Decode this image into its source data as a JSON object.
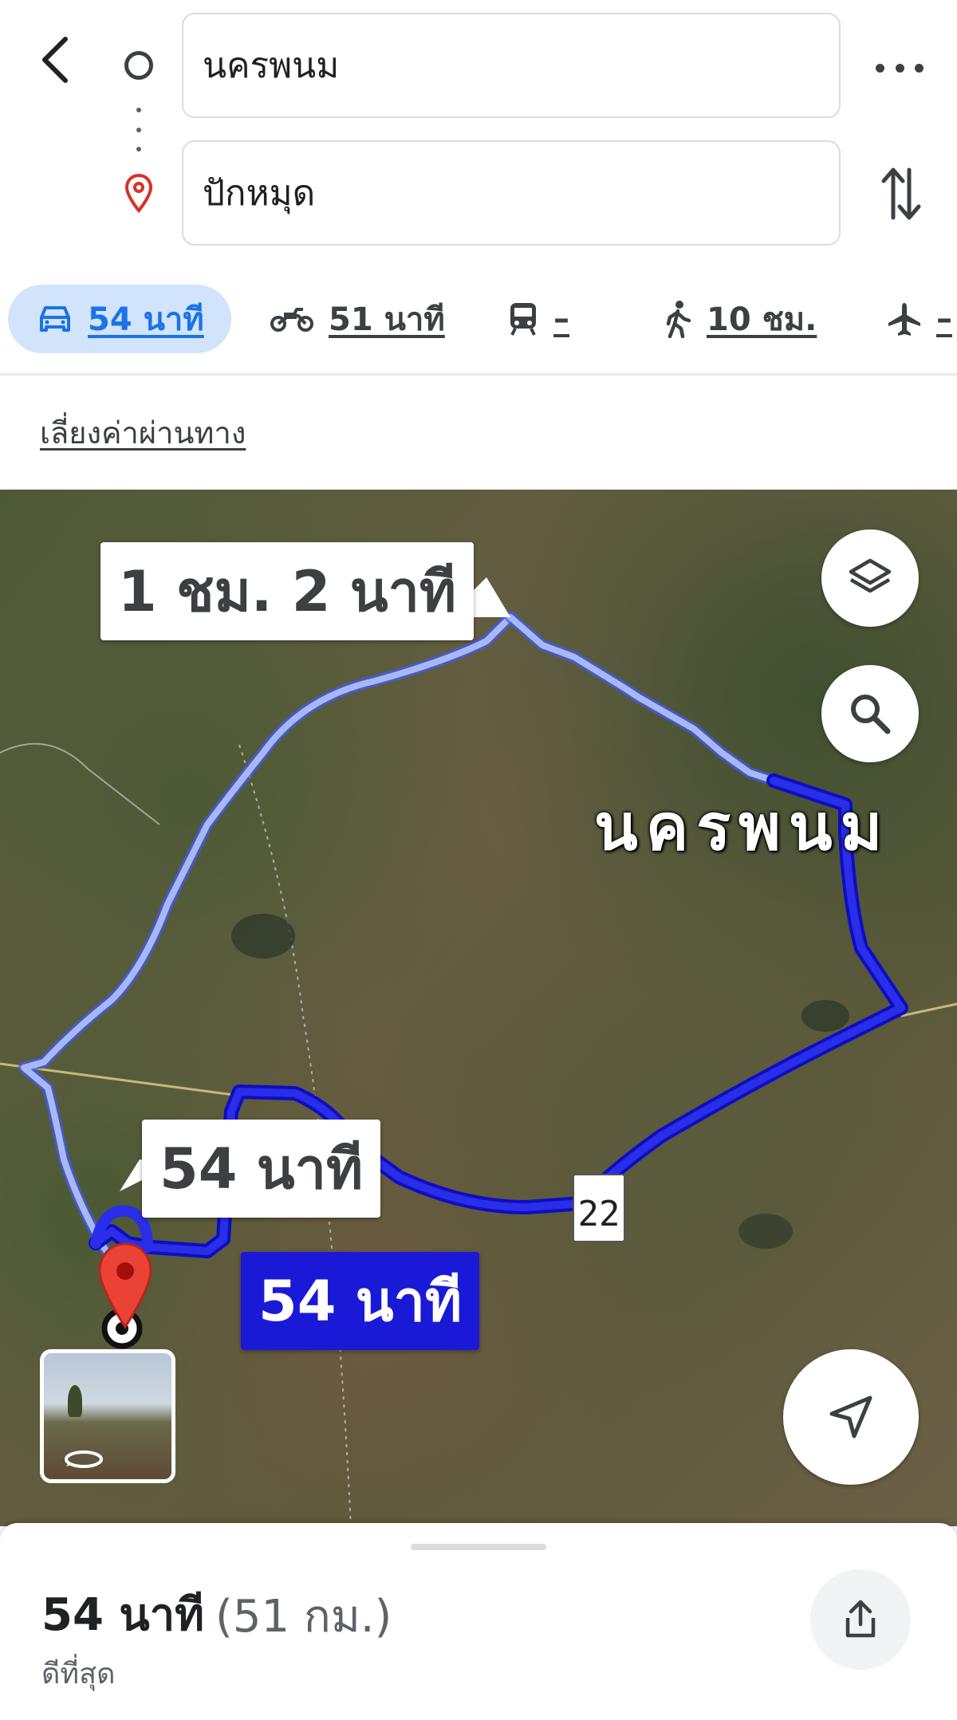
{
  "search": {
    "origin": "นครพนม",
    "destination": "ปักหมุด"
  },
  "modes": [
    {
      "name": "car",
      "label": "54 นาที",
      "active": true
    },
    {
      "name": "motorcycle",
      "label": "51 นาที"
    },
    {
      "name": "transit",
      "label": "–"
    },
    {
      "name": "walk",
      "label": "10 ชม."
    },
    {
      "name": "flight",
      "label": "–"
    }
  ],
  "options": {
    "avoid_tolls": "เลี่ยงค่าผ่านทาง"
  },
  "map": {
    "alt_route_label": "1 ชม. 2 นาที",
    "main_route_label": "54 นาที",
    "main_route_label_selected": "54 นาที",
    "city_label": "นครพนม",
    "road_shield": "22",
    "colors": {
      "main_route": "#1a1ad6",
      "alt_route": "#a9b8f5",
      "pin": "#ea4335"
    }
  },
  "summary": {
    "duration": "54 นาที",
    "distance": "(51 กม.)",
    "note": "ดีที่สุด"
  },
  "icons": [
    "back-arrow-icon",
    "origin-circle-icon",
    "route-dots-icon",
    "destination-pin-icon",
    "more-icon",
    "swap-icon",
    "car-icon",
    "motorcycle-icon",
    "transit-icon",
    "walk-icon",
    "flight-icon",
    "layers-icon",
    "search-icon",
    "navigate-icon",
    "share-icon",
    "streetview-rotate-icon"
  ]
}
